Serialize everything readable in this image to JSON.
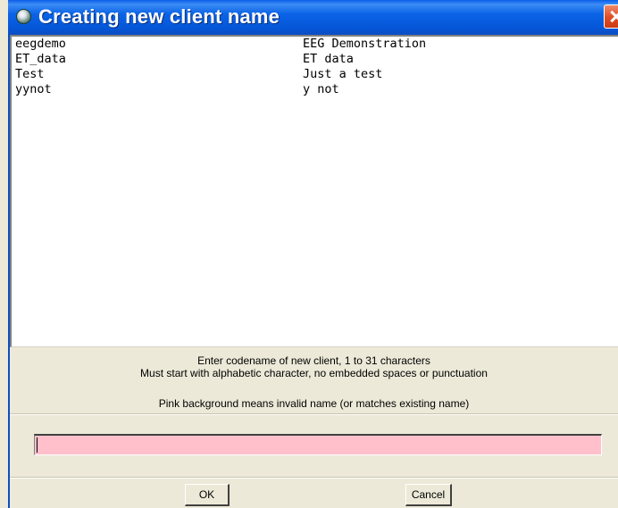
{
  "window": {
    "title": "Creating new client name"
  },
  "clients": [
    {
      "name": "eegdemo",
      "description": "EEG Demonstration"
    },
    {
      "name": "ET_data",
      "description": "ET data"
    },
    {
      "name": "Test",
      "description": "Just a test"
    },
    {
      "name": "yynot",
      "description": "y not"
    }
  ],
  "instructions": {
    "line1": "Enter codename of new client, 1 to 31 characters",
    "line2": "Must start with alphabetic character, no embedded spaces or punctuation",
    "line3": "Pink background means invalid name (or matches existing name)"
  },
  "input": {
    "value": "",
    "background_color": "#ffc0cb"
  },
  "buttons": {
    "ok_label": "OK",
    "cancel_label": "Cancel"
  },
  "colors": {
    "titlebar": "#0b63e6",
    "close_button": "#e04c24",
    "dialog_background": "#ece9d8"
  }
}
